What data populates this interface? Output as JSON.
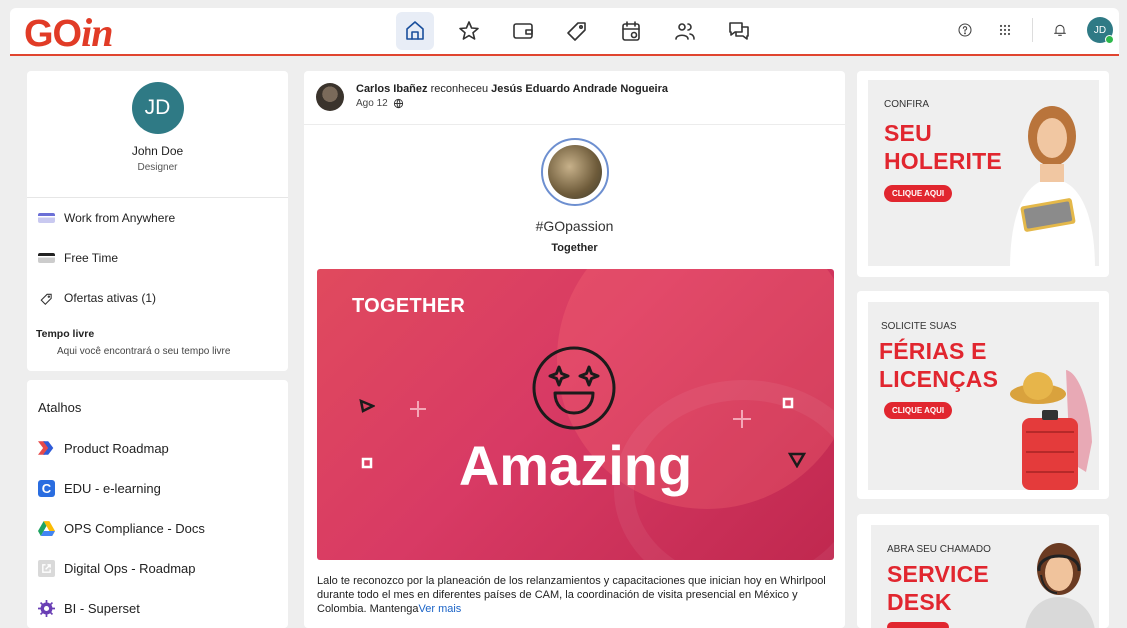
{
  "brand": {
    "logo_go": "GO",
    "logo_in": "in"
  },
  "header": {
    "nav": [
      {
        "icon": "home-icon",
        "active": true
      },
      {
        "icon": "star-icon",
        "active": false
      },
      {
        "icon": "wallet-icon",
        "active": false
      },
      {
        "icon": "tag-icon",
        "active": false
      },
      {
        "icon": "calendar-icon",
        "active": false
      },
      {
        "icon": "people-icon",
        "active": false
      },
      {
        "icon": "chat-icon",
        "active": false
      }
    ],
    "tools": [
      "help-icon",
      "apps-grid-icon",
      "bell-icon"
    ],
    "user_initials": "JD"
  },
  "profile": {
    "initials": "JD",
    "name": "John Doe",
    "role": "Designer",
    "items": [
      {
        "label": "Work from Anywhere",
        "icon": "wfa-icon"
      },
      {
        "label": "Free Time",
        "icon": "free-time-icon"
      },
      {
        "label": "Ofertas ativas (1)",
        "icon": "tag-icon"
      }
    ],
    "tempo_title": "Tempo livre",
    "tempo_sub": "Aqui você encontrará o seu tempo livre"
  },
  "shortcuts": {
    "title": "Atalhos",
    "items": [
      {
        "label": "Product Roadmap",
        "icon": "productboard-icon"
      },
      {
        "label": "EDU - e-learning",
        "icon": "edu-icon"
      },
      {
        "label": "OPS Compliance - Docs",
        "icon": "google-drive-icon"
      },
      {
        "label": "Digital Ops - Roadmap",
        "icon": "external-link-icon"
      },
      {
        "label": "BI - Superset",
        "icon": "superset-icon"
      }
    ]
  },
  "post": {
    "author": "Carlos Ibañez",
    "verb": "reconheceu",
    "recipient": "Jesús Eduardo Andrade Nogueira",
    "date": "Ago 12",
    "hashtag": "#GOpassion",
    "value": "Together",
    "banner_tag": "TOGETHER",
    "banner_word": "Amazing",
    "text": "Lalo te reconozco por la planeación de los relanzamientos y capacitaciones que inician hoy en Whirlpool durante todo el mes en diferentes países de CAM, la coordinación de visita presencial en México y Colombia. Mantenga",
    "more": "Ver mais"
  },
  "ads": [
    {
      "small": "CONFIRA",
      "big1": "SEU",
      "big2": "HOLERITE",
      "button": "CLIQUE AQUI"
    },
    {
      "small": "SOLICITE SUAS",
      "big1": "FÉRIAS E",
      "big2": "LICENÇAS",
      "button": "CLIQUE AQUI"
    },
    {
      "small": "ABRA SEU CHAMADO",
      "big1": "SERVICE",
      "big2": "DESK",
      "button": ""
    }
  ],
  "colors": {
    "brand_red": "#e13b26",
    "accent_blue": "#1a4f9c",
    "avatar_teal": "#2f7a85"
  }
}
